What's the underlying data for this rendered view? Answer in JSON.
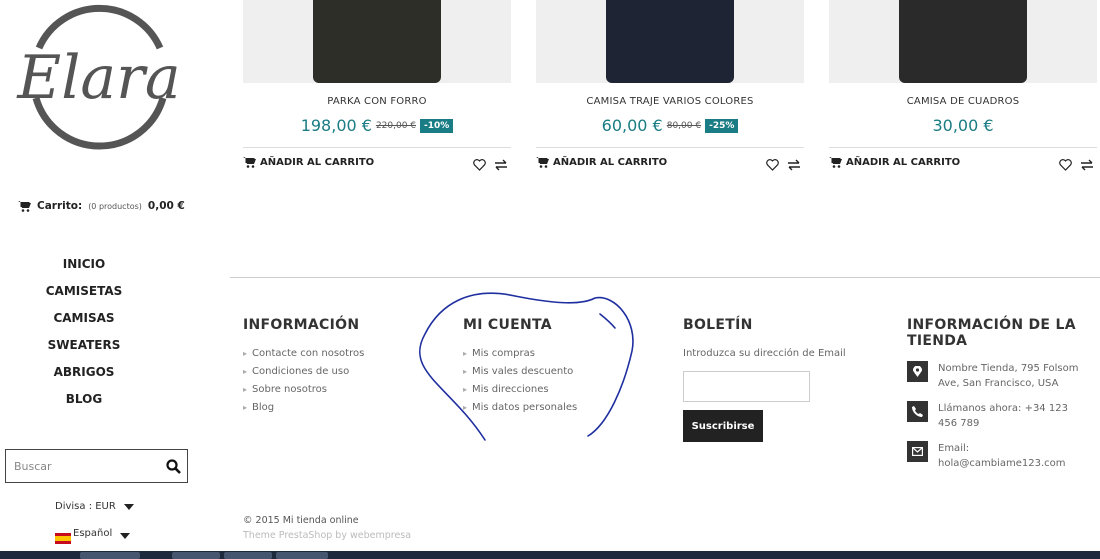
{
  "logo": {
    "text": "Elara"
  },
  "cart": {
    "label": "Carrito:",
    "count_text": "(0 productos)",
    "total": "0,00 €"
  },
  "nav": [
    "INICIO",
    "CAMISETAS",
    "CAMISAS",
    "SWEATERS",
    "ABRIGOS",
    "BLOG"
  ],
  "search": {
    "placeholder": "Buscar"
  },
  "currency": {
    "label": "Divisa : EUR"
  },
  "language": {
    "label": "Español"
  },
  "products": [
    {
      "name": "PARKA CON FORRO",
      "price": "198,00 €",
      "old_price": "220,00 €",
      "discount": "-10%",
      "add_to_cart": "AÑADIR AL CARRITO",
      "color": "#2e2e28"
    },
    {
      "name": "CAMISA TRAJE VARIOS COLORES",
      "price": "60,00 €",
      "old_price": "80,00 €",
      "discount": "-25%",
      "add_to_cart": "AÑADIR AL CARRITO",
      "color": "#1e2433"
    },
    {
      "name": "CAMISA DE CUADROS",
      "price": "30,00 €",
      "old_price": "",
      "discount": "",
      "add_to_cart": "AÑADIR AL CARRITO",
      "color": "#2a2a2a"
    }
  ],
  "footer": {
    "informacion": {
      "title": "INFORMACIÓN",
      "links": [
        "Contacte con nosotros",
        "Condiciones de uso",
        "Sobre nosotros",
        "Blog"
      ]
    },
    "mi_cuenta": {
      "title": "MI CUENTA",
      "links": [
        "Mis compras",
        "Mis vales descuento",
        "Mis direcciones",
        "Mis datos personales"
      ]
    },
    "boletin": {
      "title": "BOLETÍN",
      "text": "Introduzca su dirección de Email",
      "button": "Suscribirse"
    },
    "info_tienda": {
      "title": "INFORMACIÓN DE LA TIENDA",
      "address": "Nombre Tienda, 795 Folsom Ave, San Francisco, USA",
      "phone": "Llámanos ahora: +34 123 456 789",
      "email": "Email: hola@cambiame123.com"
    },
    "copyright": "© 2015 Mi tienda online",
    "theme": "Theme PrestaShop by webempresa"
  },
  "colors": {
    "accent": "#1a7c84",
    "scribble": "#1f2fa0"
  }
}
